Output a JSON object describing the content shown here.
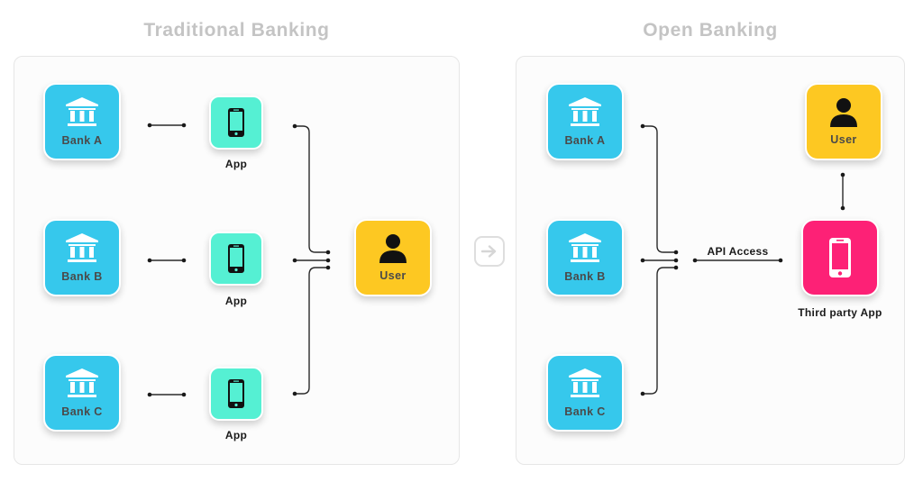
{
  "traditional": {
    "title": "Traditional Banking",
    "banks": [
      {
        "label": "Bank A",
        "icon": "bank-icon"
      },
      {
        "label": "Bank B",
        "icon": "bank-icon"
      },
      {
        "label": "Bank C",
        "icon": "bank-icon"
      }
    ],
    "apps": [
      {
        "label": "App",
        "icon": "smartphone-icon"
      },
      {
        "label": "App",
        "icon": "smartphone-icon"
      },
      {
        "label": "App",
        "icon": "smartphone-icon"
      }
    ],
    "user": {
      "label": "User",
      "icon": "user-icon"
    }
  },
  "transition": {
    "icon": "arrow-right-icon"
  },
  "open": {
    "title": "Open Banking",
    "banks": [
      {
        "label": "Bank A",
        "icon": "bank-icon"
      },
      {
        "label": "Bank B",
        "icon": "bank-icon"
      },
      {
        "label": "Bank C",
        "icon": "bank-icon"
      }
    ],
    "api_label": "API Access",
    "user": {
      "label": "User",
      "icon": "user-icon"
    },
    "third_party": {
      "label": "Third party App",
      "icon": "smartphone-icon"
    }
  },
  "colors": {
    "bank": "#36c8ec",
    "app": "#55f0d3",
    "user": "#fdc822",
    "third_party": "#fd2176",
    "title": "#c4c4c4"
  }
}
